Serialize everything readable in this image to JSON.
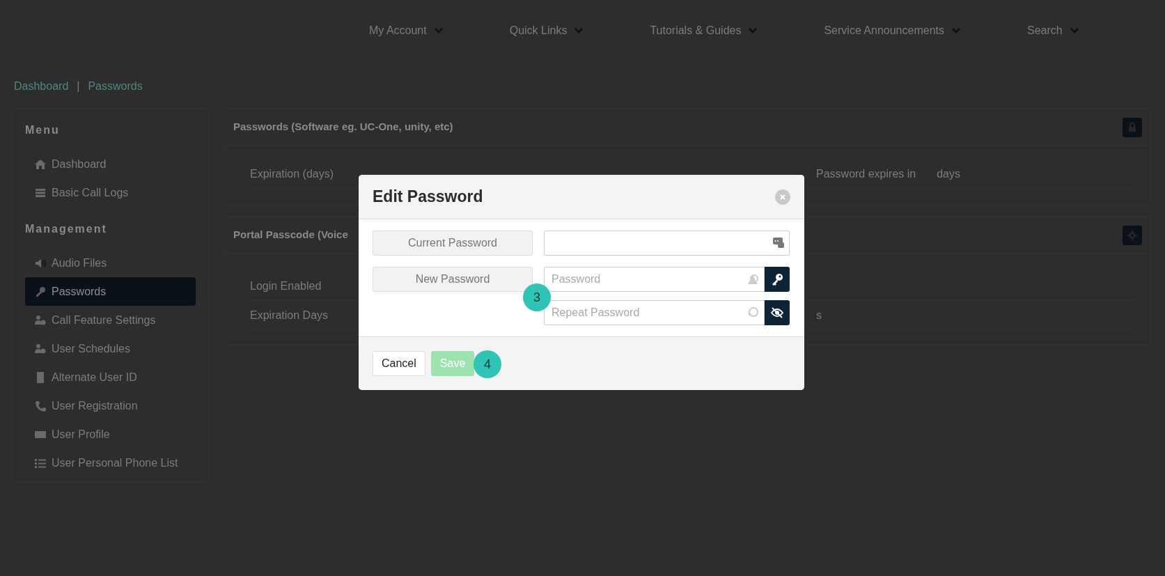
{
  "nav": [
    {
      "label": "My Account"
    },
    {
      "label": "Quick Links"
    },
    {
      "label": "Tutorials & Guides"
    },
    {
      "label": "Service Announcements"
    },
    {
      "label": "Search"
    }
  ],
  "breadcrumb": {
    "items": [
      "Dashboard",
      "Passwords"
    ],
    "separator": "|"
  },
  "sidebar": {
    "sections": [
      {
        "title": "Menu",
        "items": [
          {
            "label": "Dashboard",
            "selected": false
          },
          {
            "label": "Basic Call Logs",
            "selected": false
          }
        ]
      },
      {
        "title": "Management",
        "items": [
          {
            "label": "Audio Files",
            "selected": false
          },
          {
            "label": "Passwords",
            "selected": true
          },
          {
            "label": "Call Feature Settings",
            "selected": false
          },
          {
            "label": "User Schedules",
            "selected": false
          },
          {
            "label": "Alternate User ID",
            "selected": false
          },
          {
            "label": "User Registration",
            "selected": false
          },
          {
            "label": "User Profile",
            "selected": false
          },
          {
            "label": "User Personal Phone List",
            "selected": false
          }
        ]
      }
    ]
  },
  "panels": [
    {
      "title": "Passwords (Software eg. UC-One, unity, etc)",
      "rows": [
        {
          "label": "Expiration (days)",
          "value": "Password expires in",
          "unit": "days"
        }
      ]
    },
    {
      "title": "Portal Passcode (Voice",
      "rows": [
        {
          "label": "Login Enabled"
        },
        {
          "label": "Expiration Days",
          "value": "s"
        }
      ]
    }
  ],
  "modal": {
    "title": "Edit Password",
    "current_label": "Current Password",
    "new_label": "New Password",
    "password_placeholder": "Password",
    "repeat_placeholder": "Repeat Password",
    "buttons": [
      {
        "label": "Cancel",
        "kind": "secondary",
        "disabled": false
      },
      {
        "label": "Save",
        "kind": "primary",
        "disabled": true
      }
    ]
  },
  "step_markers": [
    {
      "label": "3"
    },
    {
      "label": "4"
    }
  ]
}
